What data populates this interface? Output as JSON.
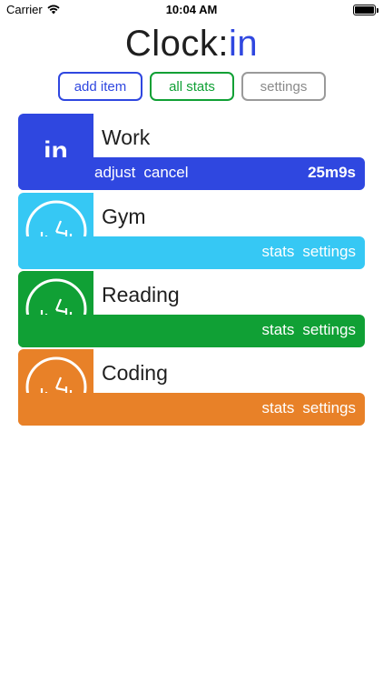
{
  "status": {
    "carrier": "Carrier",
    "time": "10:04 AM"
  },
  "title": {
    "main": "Clock:",
    "accent": "in"
  },
  "buttons": {
    "add": "add item",
    "stats": "all stats",
    "settings": "settings"
  },
  "items": [
    {
      "name": "Work",
      "color": "#2f47e0",
      "active": true,
      "tile_label": "in",
      "actions": [
        "adjust",
        "cancel"
      ],
      "timer": "25m9s"
    },
    {
      "name": "Gym",
      "color": "#36c8f4",
      "active": false,
      "actions": [
        "stats",
        "settings"
      ]
    },
    {
      "name": "Reading",
      "color": "#10a035",
      "active": false,
      "actions": [
        "stats",
        "settings"
      ]
    },
    {
      "name": "Coding",
      "color": "#e88128",
      "active": false,
      "actions": [
        "stats",
        "settings"
      ]
    }
  ],
  "icons": {
    "wifi": "wifi-icon",
    "battery": "battery-icon",
    "clock": "clock-icon"
  }
}
